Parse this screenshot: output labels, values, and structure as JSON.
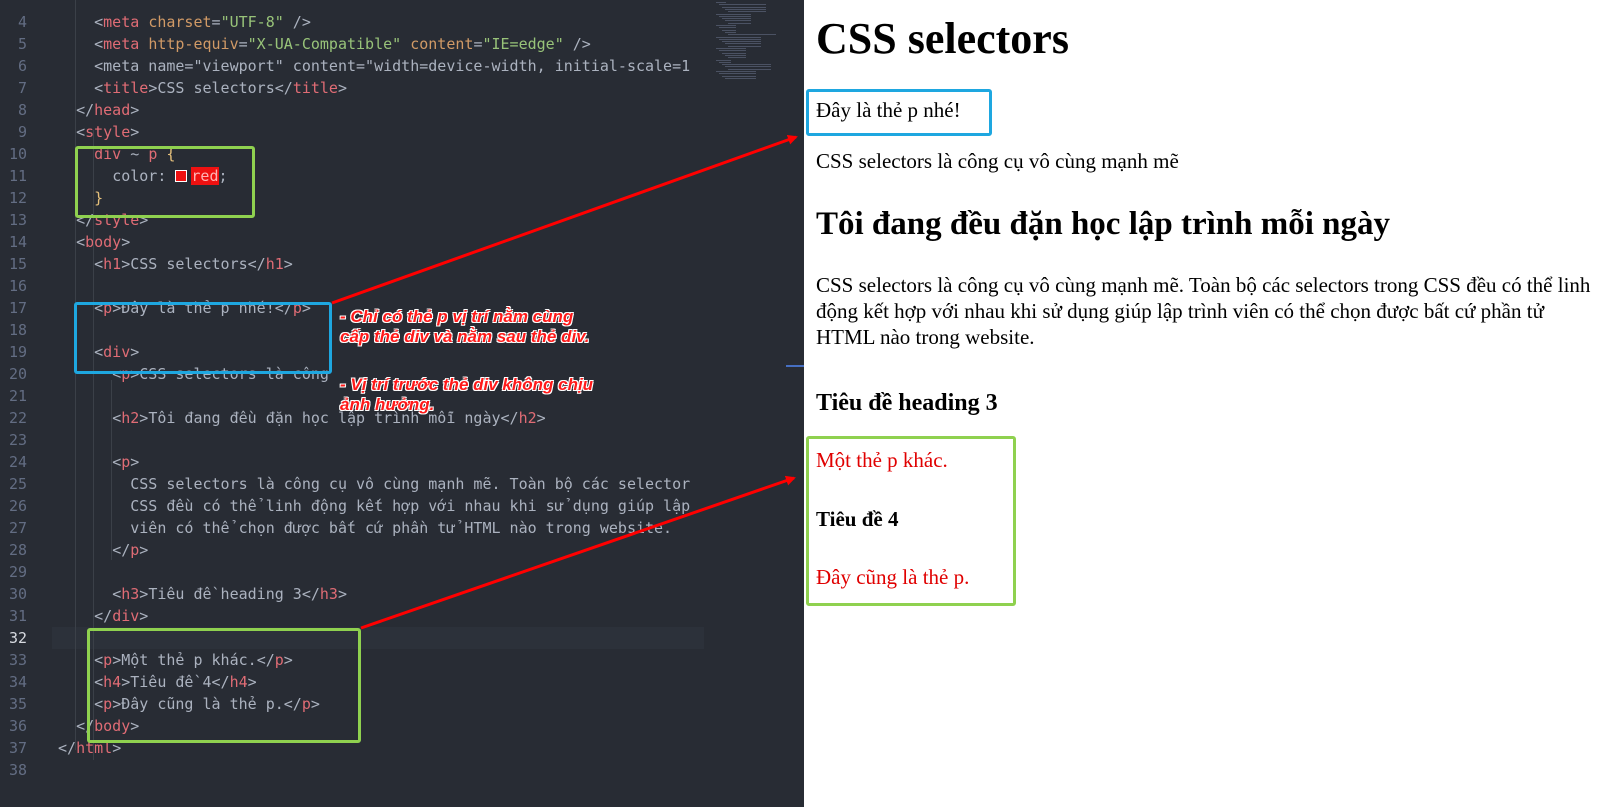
{
  "editor": {
    "active_line": "32",
    "lines": [
      {
        "n": "4",
        "t": "    <meta charset=\"UTF-8\" />"
      },
      {
        "n": "5",
        "t": "    <meta http-equiv=\"X-UA-Compatible\" content=\"IE=edge\" />"
      },
      {
        "n": "6",
        "t": "    <meta name=\"viewport\" content=\"width=device-width, initial-scale=1"
      },
      {
        "n": "7",
        "t": "    <title>CSS selectors</title>"
      },
      {
        "n": "8",
        "t": "  </head>"
      },
      {
        "n": "9",
        "t": "  <style>"
      },
      {
        "n": "10",
        "t": "    div ~ p {"
      },
      {
        "n": "11",
        "t": "      color: red;"
      },
      {
        "n": "12",
        "t": "    }"
      },
      {
        "n": "13",
        "t": "  </style>"
      },
      {
        "n": "14",
        "t": "  <body>"
      },
      {
        "n": "15",
        "t": "    <h1>CSS selectors</h1>"
      },
      {
        "n": "16",
        "t": ""
      },
      {
        "n": "17",
        "t": "    <p>Đây là thẻ p nhé!</p>"
      },
      {
        "n": "18",
        "t": ""
      },
      {
        "n": "19",
        "t": "    <div>"
      },
      {
        "n": "20",
        "t": "      <p>CSS selectors là công"
      },
      {
        "n": "21",
        "t": ""
      },
      {
        "n": "22",
        "t": "      <h2>Tôi đang đều đặn học lập trình mỗi ngày</h2>"
      },
      {
        "n": "23",
        "t": ""
      },
      {
        "n": "24",
        "t": "      <p>"
      },
      {
        "n": "25",
        "t": "        CSS selectors là công cụ vô cùng mạnh mẽ. Toàn bộ các selector"
      },
      {
        "n": "26",
        "t": "        CSS đều có thể linh động kết hợp với nhau khi sử dụng giúp lập"
      },
      {
        "n": "27",
        "t": "        viên có thể chọn được bất cứ phần tử HTML nào trong website."
      },
      {
        "n": "28",
        "t": "      </p>"
      },
      {
        "n": "29",
        "t": ""
      },
      {
        "n": "30",
        "t": "      <h3>Tiêu đề heading 3</h3>"
      },
      {
        "n": "31",
        "t": "    </div>"
      },
      {
        "n": "32",
        "t": ""
      },
      {
        "n": "33",
        "t": "    <p>Một thẻ p khác.</p>"
      },
      {
        "n": "34",
        "t": "    <h4>Tiêu đề 4</h4>"
      },
      {
        "n": "35",
        "t": "    <p>Đây cũng là thẻ p.</p>"
      },
      {
        "n": "36",
        "t": "  </body>"
      },
      {
        "n": "37",
        "t": "</html>"
      },
      {
        "n": "38",
        "t": ""
      }
    ]
  },
  "annotations": {
    "note1": "- Chỉ có thẻ p vị trí nằm cùng\ncấp thẻ div và nằm sau thẻ div.",
    "note2": "- Vị trí trước thẻ div không chịu\nảnh hưởng."
  },
  "preview": {
    "h1": "CSS selectors",
    "p1": "Đây là thẻ p nhé!",
    "p2": "CSS selectors là công cụ vô cùng mạnh mẽ",
    "h2": "Tôi đang đều đặn học lập trình mỗi ngày",
    "p3": "CSS selectors là công cụ vô cùng mạnh mẽ. Toàn bộ các selectors trong CSS đều có thể linh động kết hợp với nhau khi sử dụng giúp lập trình viên có thể chọn được bất cứ phần tử HTML nào trong website.",
    "h3": "Tiêu đề heading 3",
    "p4": "Một thẻ p khác.",
    "h4": "Tiêu đề 4",
    "p5": "Đây cũng là thẻ p."
  },
  "colors": {
    "editor_bg": "#282c34",
    "tag": "#e06c75",
    "attr": "#d19a66",
    "string": "#98c379",
    "highlight_blue": "#1ea7e0",
    "highlight_green": "#8fd14f",
    "arrow_red": "#ff0000",
    "matched_text": "#e00000"
  }
}
